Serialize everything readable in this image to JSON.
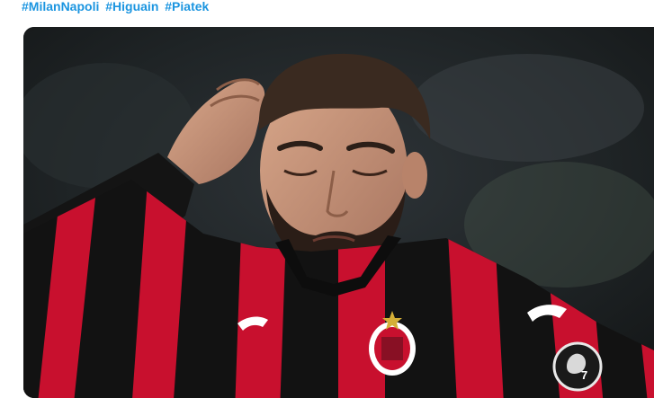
{
  "tweet": {
    "hashtags": [
      "#MilanNapoli",
      "#Higuain",
      "#Piatek"
    ]
  },
  "media": {
    "alt": "",
    "badge_number": "7",
    "colors": {
      "red": "#c8102e",
      "black": "#121212",
      "skin": "#c89478",
      "hair": "#3a2a20",
      "background": "#1e2224"
    }
  }
}
